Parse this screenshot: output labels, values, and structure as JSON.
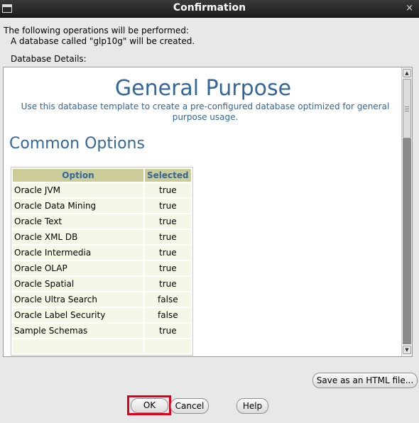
{
  "window": {
    "title": "Confirmation",
    "close_glyph": "×",
    "icon": "window-icon"
  },
  "summary": {
    "line1": "The following operations will be performed:",
    "line2": "A database called \"glp10g\" will be created.",
    "details_label": "Database Details:"
  },
  "details": {
    "heading": "General Purpose",
    "description": "Use this database template to create a pre-configured database optimized for general purpose usage.",
    "section": "Common Options",
    "table": {
      "headers": [
        "Option",
        "Selected"
      ],
      "rows": [
        [
          "Oracle JVM",
          "true"
        ],
        [
          "Oracle Data Mining",
          "true"
        ],
        [
          "Oracle Text",
          "true"
        ],
        [
          "Oracle XML DB",
          "true"
        ],
        [
          "Oracle Intermedia",
          "true"
        ],
        [
          "Oracle OLAP",
          "true"
        ],
        [
          "Oracle Spatial",
          "true"
        ],
        [
          "Oracle Ultra Search",
          "false"
        ],
        [
          "Oracle Label Security",
          "false"
        ],
        [
          "Sample Schemas",
          "true"
        ]
      ]
    }
  },
  "buttons": {
    "save_html": "Save as an HTML file...",
    "ok": "OK",
    "cancel": "Cancel",
    "help": "Help"
  },
  "colors": {
    "heading": "#336699",
    "table_header": "#cccc99",
    "table_cell": "#f7f7e7",
    "highlight": "#e0001b"
  }
}
